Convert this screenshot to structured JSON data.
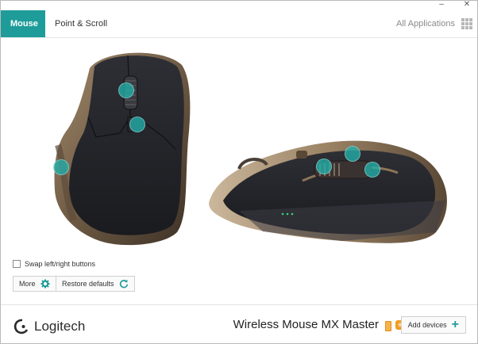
{
  "window": {
    "minimize": "–",
    "close": "✕"
  },
  "tabs": [
    {
      "label": "Mouse",
      "active": true
    },
    {
      "label": "Point & Scroll",
      "active": false
    }
  ],
  "all_apps": {
    "label": "All Applications",
    "icon": "grid-icon"
  },
  "options": {
    "swap_buttons_label": "Swap left/right buttons",
    "swap_checked": false
  },
  "buttons": {
    "more_label": "More",
    "restore_label": "Restore defaults"
  },
  "footer": {
    "brand": "Logitech",
    "device_name": "Wireless Mouse MX Master",
    "add_devices_label": "Add devices"
  },
  "colors": {
    "accent": "#1e9c9a",
    "hotspot": "#23afaa",
    "battery": "#f39a1e"
  },
  "icons": [
    "gear-icon",
    "restore-icon",
    "battery-icon",
    "unifying-receiver-icon",
    "plus-icon",
    "logitech-logo-icon"
  ]
}
